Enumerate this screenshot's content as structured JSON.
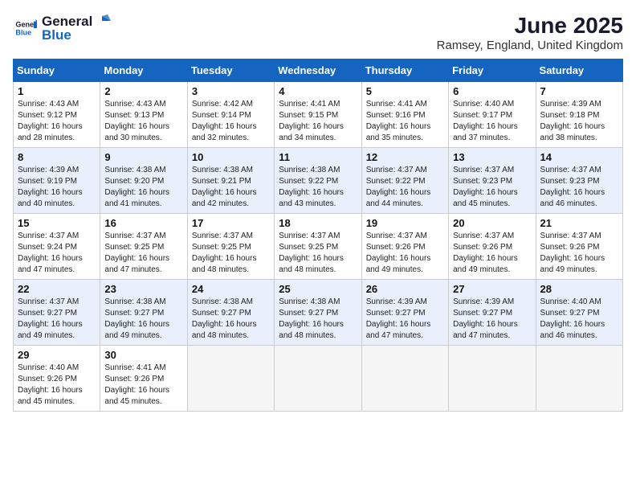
{
  "logo": {
    "general": "General",
    "blue": "Blue"
  },
  "title": "June 2025",
  "location": "Ramsey, England, United Kingdom",
  "days_of_week": [
    "Sunday",
    "Monday",
    "Tuesday",
    "Wednesday",
    "Thursday",
    "Friday",
    "Saturday"
  ],
  "weeks": [
    {
      "shade": "white",
      "days": [
        {
          "num": "1",
          "info": "Sunrise: 4:43 AM\nSunset: 9:12 PM\nDaylight: 16 hours and 28 minutes."
        },
        {
          "num": "2",
          "info": "Sunrise: 4:43 AM\nSunset: 9:13 PM\nDaylight: 16 hours and 30 minutes."
        },
        {
          "num": "3",
          "info": "Sunrise: 4:42 AM\nSunset: 9:14 PM\nDaylight: 16 hours and 32 minutes."
        },
        {
          "num": "4",
          "info": "Sunrise: 4:41 AM\nSunset: 9:15 PM\nDaylight: 16 hours and 34 minutes."
        },
        {
          "num": "5",
          "info": "Sunrise: 4:41 AM\nSunset: 9:16 PM\nDaylight: 16 hours and 35 minutes."
        },
        {
          "num": "6",
          "info": "Sunrise: 4:40 AM\nSunset: 9:17 PM\nDaylight: 16 hours and 37 minutes."
        },
        {
          "num": "7",
          "info": "Sunrise: 4:39 AM\nSunset: 9:18 PM\nDaylight: 16 hours and 38 minutes."
        }
      ]
    },
    {
      "shade": "shade",
      "days": [
        {
          "num": "8",
          "info": "Sunrise: 4:39 AM\nSunset: 9:19 PM\nDaylight: 16 hours and 40 minutes."
        },
        {
          "num": "9",
          "info": "Sunrise: 4:38 AM\nSunset: 9:20 PM\nDaylight: 16 hours and 41 minutes."
        },
        {
          "num": "10",
          "info": "Sunrise: 4:38 AM\nSunset: 9:21 PM\nDaylight: 16 hours and 42 minutes."
        },
        {
          "num": "11",
          "info": "Sunrise: 4:38 AM\nSunset: 9:22 PM\nDaylight: 16 hours and 43 minutes."
        },
        {
          "num": "12",
          "info": "Sunrise: 4:37 AM\nSunset: 9:22 PM\nDaylight: 16 hours and 44 minutes."
        },
        {
          "num": "13",
          "info": "Sunrise: 4:37 AM\nSunset: 9:23 PM\nDaylight: 16 hours and 45 minutes."
        },
        {
          "num": "14",
          "info": "Sunrise: 4:37 AM\nSunset: 9:23 PM\nDaylight: 16 hours and 46 minutes."
        }
      ]
    },
    {
      "shade": "white",
      "days": [
        {
          "num": "15",
          "info": "Sunrise: 4:37 AM\nSunset: 9:24 PM\nDaylight: 16 hours and 47 minutes."
        },
        {
          "num": "16",
          "info": "Sunrise: 4:37 AM\nSunset: 9:25 PM\nDaylight: 16 hours and 47 minutes."
        },
        {
          "num": "17",
          "info": "Sunrise: 4:37 AM\nSunset: 9:25 PM\nDaylight: 16 hours and 48 minutes."
        },
        {
          "num": "18",
          "info": "Sunrise: 4:37 AM\nSunset: 9:25 PM\nDaylight: 16 hours and 48 minutes."
        },
        {
          "num": "19",
          "info": "Sunrise: 4:37 AM\nSunset: 9:26 PM\nDaylight: 16 hours and 49 minutes."
        },
        {
          "num": "20",
          "info": "Sunrise: 4:37 AM\nSunset: 9:26 PM\nDaylight: 16 hours and 49 minutes."
        },
        {
          "num": "21",
          "info": "Sunrise: 4:37 AM\nSunset: 9:26 PM\nDaylight: 16 hours and 49 minutes."
        }
      ]
    },
    {
      "shade": "shade",
      "days": [
        {
          "num": "22",
          "info": "Sunrise: 4:37 AM\nSunset: 9:27 PM\nDaylight: 16 hours and 49 minutes."
        },
        {
          "num": "23",
          "info": "Sunrise: 4:38 AM\nSunset: 9:27 PM\nDaylight: 16 hours and 49 minutes."
        },
        {
          "num": "24",
          "info": "Sunrise: 4:38 AM\nSunset: 9:27 PM\nDaylight: 16 hours and 48 minutes."
        },
        {
          "num": "25",
          "info": "Sunrise: 4:38 AM\nSunset: 9:27 PM\nDaylight: 16 hours and 48 minutes."
        },
        {
          "num": "26",
          "info": "Sunrise: 4:39 AM\nSunset: 9:27 PM\nDaylight: 16 hours and 47 minutes."
        },
        {
          "num": "27",
          "info": "Sunrise: 4:39 AM\nSunset: 9:27 PM\nDaylight: 16 hours and 47 minutes."
        },
        {
          "num": "28",
          "info": "Sunrise: 4:40 AM\nSunset: 9:27 PM\nDaylight: 16 hours and 46 minutes."
        }
      ]
    },
    {
      "shade": "white",
      "days": [
        {
          "num": "29",
          "info": "Sunrise: 4:40 AM\nSunset: 9:26 PM\nDaylight: 16 hours and 45 minutes."
        },
        {
          "num": "30",
          "info": "Sunrise: 4:41 AM\nSunset: 9:26 PM\nDaylight: 16 hours and 45 minutes."
        },
        {
          "num": "",
          "info": ""
        },
        {
          "num": "",
          "info": ""
        },
        {
          "num": "",
          "info": ""
        },
        {
          "num": "",
          "info": ""
        },
        {
          "num": "",
          "info": ""
        }
      ]
    }
  ]
}
